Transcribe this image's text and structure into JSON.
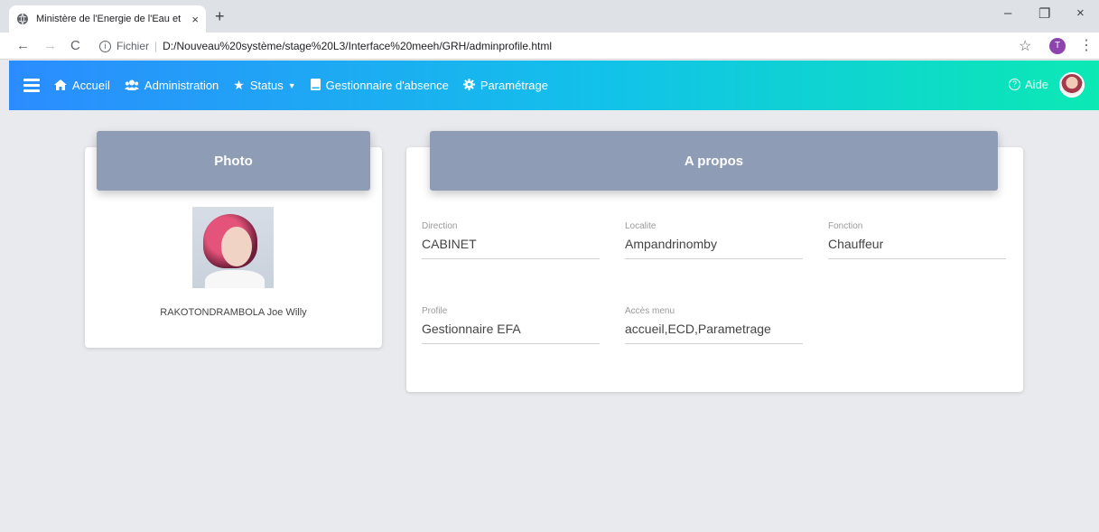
{
  "browser": {
    "tab_title": "Ministère de l'Energie de l'Eau et",
    "tab_close": "×",
    "new_tab": "+",
    "win_minimize": "–",
    "win_restore": "❐",
    "win_close": "×",
    "address_prefix": "Fichier",
    "address_sep": "|",
    "url": "D:/Nouveau%20système/stage%20L3/Interface%20meeh/GRH/adminprofile.html",
    "profile_initial": "T"
  },
  "nav": {
    "items": [
      {
        "label": "Accueil",
        "icon": "home-icon"
      },
      {
        "label": "Administration",
        "icon": "users-icon"
      },
      {
        "label": "Status",
        "icon": "star-icon"
      },
      {
        "label": "Gestionnaire d'absence",
        "icon": "book-icon"
      },
      {
        "label": "Paramétrage",
        "icon": "gear-icon"
      }
    ],
    "help_label": "Aide"
  },
  "photo_card": {
    "title": "Photo",
    "name": "RAKOTONDRAMBOLA Joe Willy"
  },
  "about_card": {
    "title": "A propos",
    "fields": [
      {
        "label": "Direction",
        "value": "CABINET"
      },
      {
        "label": "Localite",
        "value": "Ampandrinomby"
      },
      {
        "label": "Fonction",
        "value": "Chauffeur"
      },
      {
        "label": "Profile",
        "value": "Gestionnaire EFA"
      },
      {
        "label": "Accès menu",
        "value": "accueil,ECD,Parametrage"
      }
    ]
  },
  "colors": {
    "nav_gradient_start": "#2b8cff",
    "nav_gradient_end": "#0be9b4",
    "card_header": "#8e9cb6",
    "page_bg": "#e9eaee"
  }
}
